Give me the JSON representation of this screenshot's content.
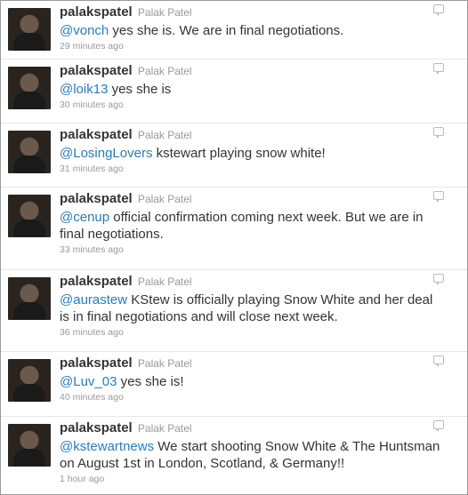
{
  "tweets": [
    {
      "screen_name": "palakspatel",
      "full_name": "Palak Patel",
      "mention": "@vonch",
      "text": " yes she is. We are in final negotiations.",
      "time": "29 minutes ago"
    },
    {
      "screen_name": "palakspatel",
      "full_name": "Palak Patel",
      "mention": "@loik13",
      "text": " yes she is",
      "time": "30 minutes ago"
    },
    {
      "screen_name": "palakspatel",
      "full_name": "Palak Patel",
      "mention": "@LosingLovers",
      "text": " kstewart playing snow white!",
      "time": "31 minutes ago"
    },
    {
      "screen_name": "palakspatel",
      "full_name": "Palak Patel",
      "mention": "@cenup",
      "text": " official confirmation coming next week. But we are in final negotiations.",
      "time": "33 minutes ago"
    },
    {
      "screen_name": "palakspatel",
      "full_name": "Palak Patel",
      "mention": "@aurastew",
      "text": " KStew is officially playing Snow White and her deal is in final negotiations and will close next week.",
      "time": "36 minutes ago"
    },
    {
      "screen_name": "palakspatel",
      "full_name": "Palak Patel",
      "mention": "@Luv_03",
      "text": " yes she is!",
      "time": "40 minutes ago"
    },
    {
      "screen_name": "palakspatel",
      "full_name": "Palak Patel",
      "mention": "@kstewartnews",
      "text": " We start shooting Snow White & The Huntsman on August 1st in London, Scotland, & Germany!!",
      "time": "1 hour ago"
    }
  ],
  "colors": {
    "mention": "#2b7bb9",
    "text": "#333333",
    "meta": "#999999"
  }
}
